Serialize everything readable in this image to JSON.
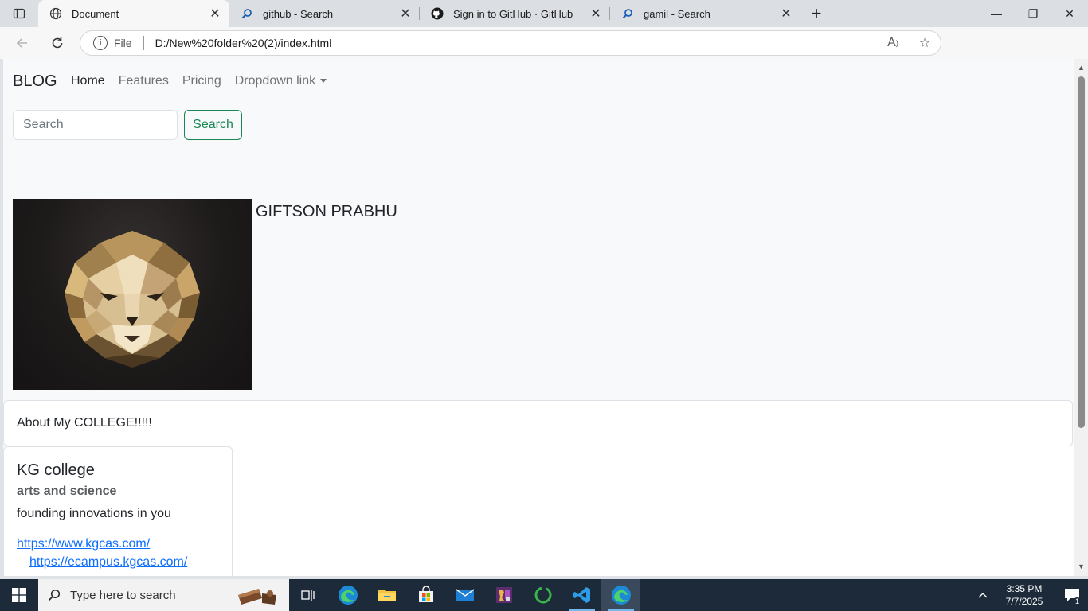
{
  "browser": {
    "tabs": [
      {
        "title": "Document",
        "icon": "globe-icon",
        "active": true
      },
      {
        "title": "github - Search",
        "icon": "search-icon",
        "active": false
      },
      {
        "title": "Sign in to GitHub · GitHub",
        "icon": "github-icon",
        "active": false
      },
      {
        "title": "gamil - Search",
        "icon": "search-icon",
        "active": false
      }
    ],
    "address": {
      "scheme_label": "File",
      "url": "D:/New%20folder%20(2)/index.html"
    }
  },
  "page": {
    "navbar": {
      "brand": "BLOG",
      "links": [
        {
          "label": "Home",
          "active": true
        },
        {
          "label": "Features",
          "active": false
        },
        {
          "label": "Pricing",
          "active": false
        },
        {
          "label": "Dropdown link",
          "active": false,
          "dropdown": true
        }
      ]
    },
    "search": {
      "placeholder": "Search",
      "button_label": "Search"
    },
    "profile": {
      "name": "GIFTSON PRABHU"
    },
    "about": {
      "text": "About My COLLEGE!!!!!"
    },
    "card": {
      "title": "KG college",
      "subtitle": "arts and science",
      "text": "founding innovations in you",
      "links": [
        "https://www.kgcas.com/",
        "https://ecampus.kgcas.com/"
      ]
    }
  },
  "taskbar": {
    "search_placeholder": "Type here to search",
    "time": "3:35 PM",
    "date": "7/7/2025",
    "notification_count": "1"
  },
  "colors": {
    "success": "#198754",
    "link": "#0d6efd",
    "taskbar": "#1c2a3a"
  }
}
